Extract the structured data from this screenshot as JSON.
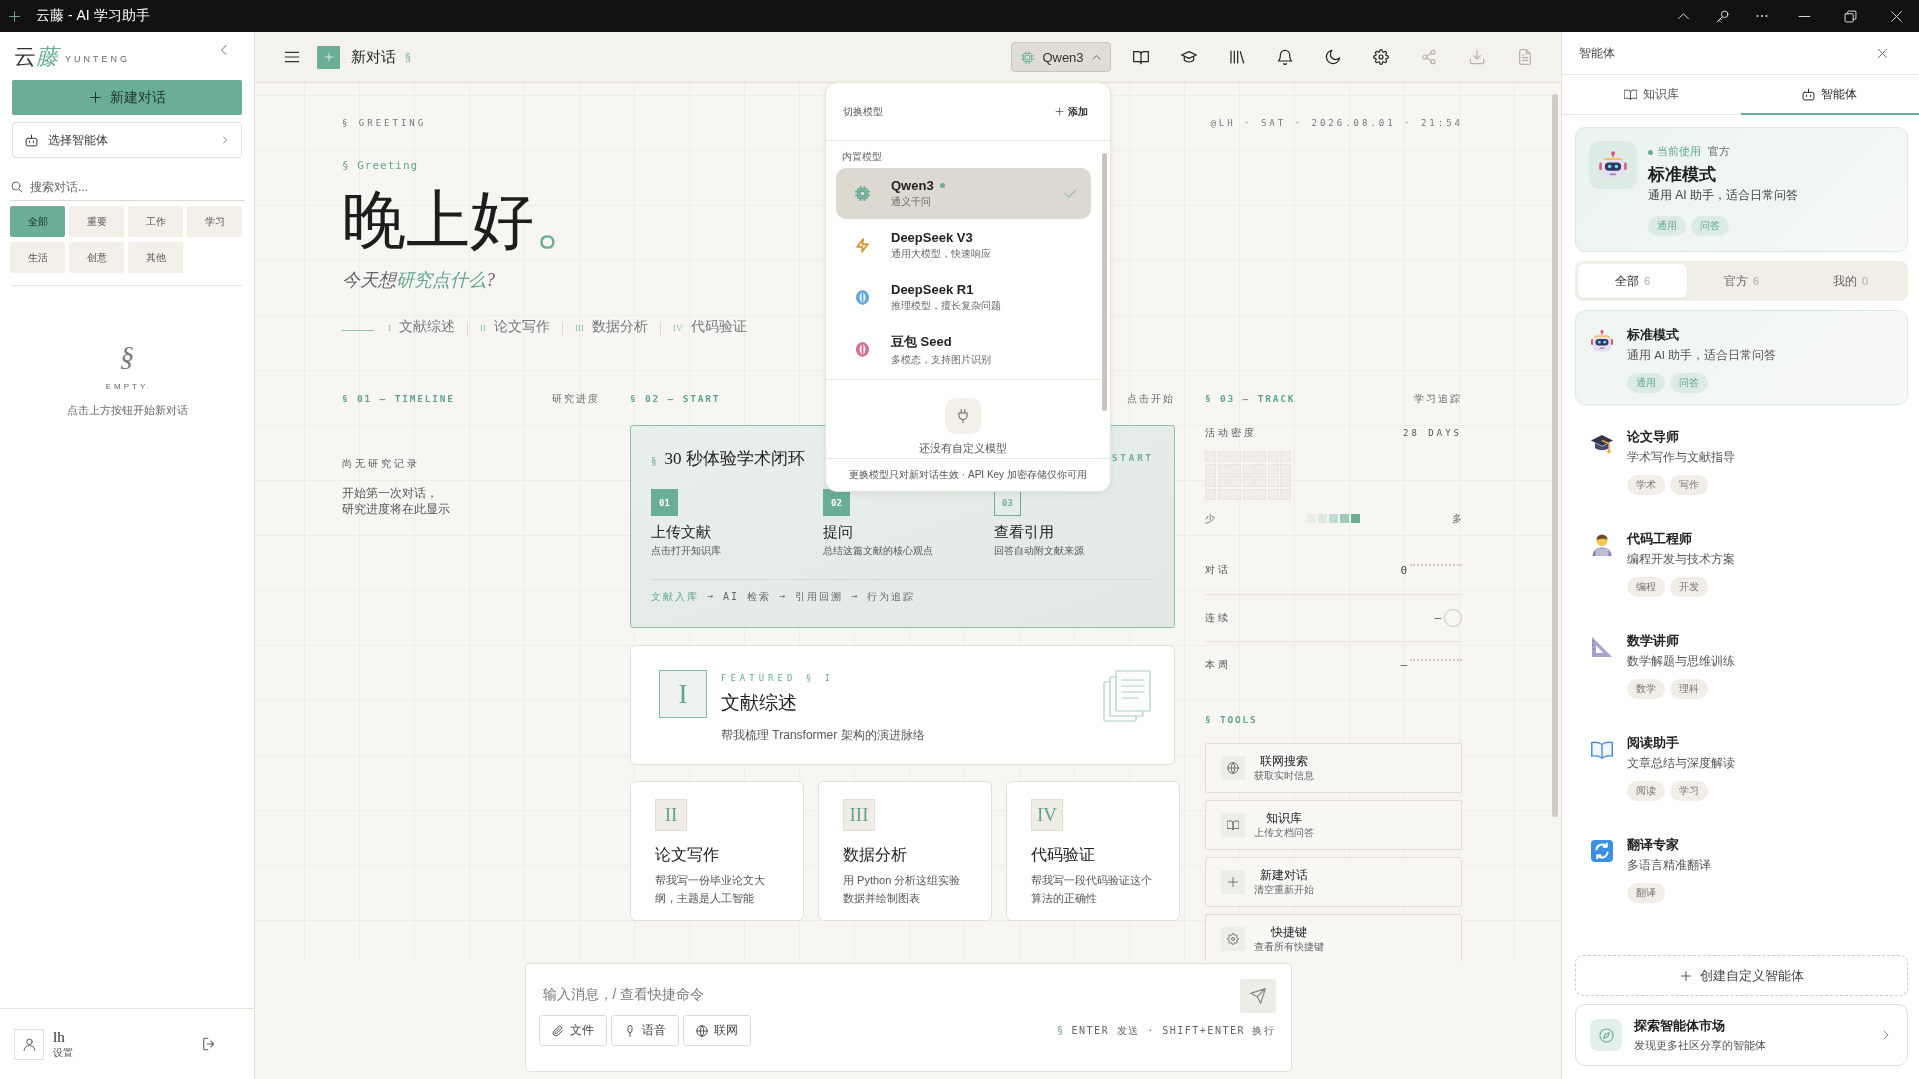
{
  "window": {
    "title": "云藤 - AI 学习助手"
  },
  "sidebar": {
    "logo": {
      "main": "云",
      "accent": "藤",
      "latin": "YUNTENG"
    },
    "new_chat": "新建对话",
    "agent_picker": "选择智能体",
    "search": {
      "placeholder": "搜索对话..."
    },
    "filters": [
      {
        "label": "全部",
        "selected": true
      },
      {
        "label": "重要",
        "selected": false
      },
      {
        "label": "工作",
        "selected": false
      },
      {
        "label": "学习",
        "selected": false
      },
      {
        "label": "生活",
        "selected": false
      },
      {
        "label": "创意",
        "selected": false
      },
      {
        "label": "其他",
        "selected": false
      }
    ],
    "empty": {
      "mark": "§",
      "label": "EMPTY",
      "hint": "点击上方按钮开始新对话"
    },
    "user": {
      "name": "lh",
      "link": "设置"
    }
  },
  "topbar": {
    "title": "新对话",
    "mark": "§",
    "model": {
      "label": "Qwen3",
      "expanded": true
    },
    "tools": [
      {
        "kind": "book",
        "disabled": false
      },
      {
        "kind": "cap",
        "disabled": false
      },
      {
        "kind": "library",
        "disabled": false
      },
      {
        "kind": "bell",
        "disabled": false
      },
      {
        "kind": "moon",
        "disabled": false
      },
      {
        "kind": "gear",
        "disabled": false
      },
      {
        "kind": "share",
        "disabled": true
      },
      {
        "kind": "download",
        "disabled": true
      },
      {
        "kind": "file",
        "disabled": true
      }
    ]
  },
  "model_menu": {
    "title": "切换模型",
    "add": "添加",
    "group": "内置模型",
    "items": [
      {
        "kind": "chip",
        "color": "#6aae97",
        "name": "Qwen3",
        "desc": "通义千问",
        "active": true,
        "selected": true
      },
      {
        "kind": "bolt",
        "color": "#d99a3c",
        "name": "DeepSeek V3",
        "desc": "通用大模型，快速响应",
        "active": false,
        "selected": false
      },
      {
        "kind": "brain",
        "color": "#5ea8e4",
        "name": "DeepSeek R1",
        "desc": "推理模型，擅长复杂问题",
        "active": false,
        "selected": false
      },
      {
        "kind": "brain",
        "color": "#d46d8c",
        "name": "豆包 Seed",
        "desc": "多模态，支持图片识别",
        "active": false,
        "selected": false
      }
    ],
    "empty": "还没有自定义模型",
    "footer": "更换模型只对新对话生效 · API Key 加密存储仅你可用"
  },
  "greeting": {
    "section": "§ GREETING",
    "meta": "@LH · SAT · 2026.08.01 · 21:54",
    "label": "§ Greeting",
    "title": "晚上好",
    "title_mark": "。",
    "prompt": {
      "lead": "今天想",
      "focus": "研究点什么",
      "tail": "?"
    },
    "shortcuts": [
      {
        "numeral": "I",
        "label": "文献综述"
      },
      {
        "numeral": "II",
        "label": "论文写作"
      },
      {
        "numeral": "III",
        "label": "数据分析"
      },
      {
        "numeral": "IV",
        "label": "代码验证"
      }
    ]
  },
  "timeline": {
    "heading": "§ 01 — TIMELINE",
    "aside": "研究进度",
    "empty_title": "尚无研究记录",
    "empty_text": [
      "开始第一次对话，",
      "研究进度将在此显示"
    ]
  },
  "start": {
    "heading": "§ 02 — START",
    "aside": "点击开始",
    "card": {
      "mark": "§",
      "title": "30 秒体验学术闭环",
      "tag": "START",
      "steps": [
        {
          "number": "01",
          "title": "上传文献",
          "desc": "点击打开知识库",
          "highlighted": true
        },
        {
          "number": "02",
          "title": "提问",
          "desc": "总结这篇文献的核心观点",
          "highlighted": true
        },
        {
          "number": "03",
          "title": "查看引用",
          "desc": "回答自动附文献来源",
          "highlighted": false
        }
      ],
      "flow": [
        {
          "label": "文献入库",
          "active": true
        },
        {
          "label": "AI 检索",
          "active": false
        },
        {
          "label": "引用回溯",
          "active": false
        },
        {
          "label": "行为追踪",
          "active": false
        }
      ],
      "flow_separator": "→"
    }
  },
  "featured": {
    "numeral": "I",
    "kicker": "FEATURED § I",
    "title": "文献综述",
    "desc": "帮我梳理 Transformer 架构的演进脉络"
  },
  "suggestions": [
    {
      "numeral": "II",
      "title": "论文写作",
      "desc": "帮我写一份毕业论文大纲，主题是人工智能"
    },
    {
      "numeral": "III",
      "title": "数据分析",
      "desc": "用 Python 分析这组实验数据并绘制图表"
    },
    {
      "numeral": "IV",
      "title": "代码验证",
      "desc": "帮我写一段代码验证这个算法的正确性"
    }
  ],
  "track": {
    "heading": "§ 03 — TRACK",
    "aside": "学习追踪",
    "density_label": "活动密度",
    "density_range": "28 DAYS",
    "legend": {
      "low": "少",
      "high": "多",
      "swatches": [
        {
          "color": "#eeece6"
        },
        {
          "color": "#dde8e2"
        },
        {
          "color": "#c3dcd1"
        },
        {
          "color": "#9ecab8"
        },
        {
          "color": "#6aae97"
        }
      ]
    },
    "stats": [
      {
        "label": "对话",
        "value": "0",
        "kind": "dotted"
      },
      {
        "label": "连续",
        "value": "—",
        "kind": "ring"
      },
      {
        "label": "本周",
        "value": "—",
        "kind": "dotted"
      }
    ],
    "tools_heading": "§ TOOLS",
    "tools": [
      {
        "kind": "globe",
        "title": "联网搜索",
        "desc": "获取实时信息"
      },
      {
        "kind": "book",
        "title": "知识库",
        "desc": "上传文档问答"
      },
      {
        "kind": "plus",
        "title": "新建对话",
        "desc": "清空重新开始"
      },
      {
        "kind": "gear",
        "title": "快捷键",
        "desc": "查看所有快捷键"
      }
    ]
  },
  "composer": {
    "placeholder": "输入消息，/ 查看快捷命令",
    "actions": [
      {
        "kind": "clip",
        "label": "文件"
      },
      {
        "kind": "mic",
        "label": "语音"
      },
      {
        "kind": "globe",
        "label": "联网"
      }
    ],
    "hint_mark": "§",
    "hint": "ENTER 发送 · SHIFT+ENTER 换行"
  },
  "panel": {
    "title": "智能体",
    "tabs": [
      {
        "kind": "book",
        "label": "知识库",
        "selected": false
      },
      {
        "kind": "robot",
        "label": "智能体",
        "selected": true
      }
    ],
    "current": {
      "status": "当前使用",
      "badge": "官方",
      "name": "标准模式",
      "desc": "通用 AI 助手，适合日常问答",
      "tags": [
        "通用",
        "问答"
      ]
    },
    "segments": [
      {
        "label": "全部",
        "count": "6",
        "selected": true
      },
      {
        "label": "官方",
        "count": "6",
        "selected": false
      },
      {
        "label": "我的",
        "count": "0",
        "selected": false
      }
    ],
    "agents": [
      {
        "kind": "robot",
        "name": "标准模式",
        "desc": "通用 AI 助手，适合日常问答",
        "tags": [
          "通用",
          "问答"
        ],
        "selected": true
      },
      {
        "kind": "cap",
        "name": "论文导师",
        "desc": "学术写作与文献指导",
        "tags": [
          "学术",
          "写作"
        ],
        "selected": false
      },
      {
        "kind": "coder",
        "name": "代码工程师",
        "desc": "编程开发与技术方案",
        "tags": [
          "编程",
          "开发"
        ],
        "selected": false
      },
      {
        "kind": "ruler",
        "name": "数学讲师",
        "desc": "数学解题与思维训练",
        "tags": [
          "数学",
          "理科"
        ],
        "selected": false
      },
      {
        "kind": "book",
        "name": "阅读助手",
        "desc": "文章总结与深度解读",
        "tags": [
          "阅读",
          "学习"
        ],
        "selected": false
      },
      {
        "kind": "swap",
        "name": "翻译专家",
        "desc": "多语言精准翻译",
        "tags": [
          "翻译"
        ],
        "selected": false
      }
    ],
    "create": "创建自定义智能体",
    "explore": {
      "title": "探索智能体市场",
      "desc": "发现更多社区分享的智能体"
    }
  }
}
